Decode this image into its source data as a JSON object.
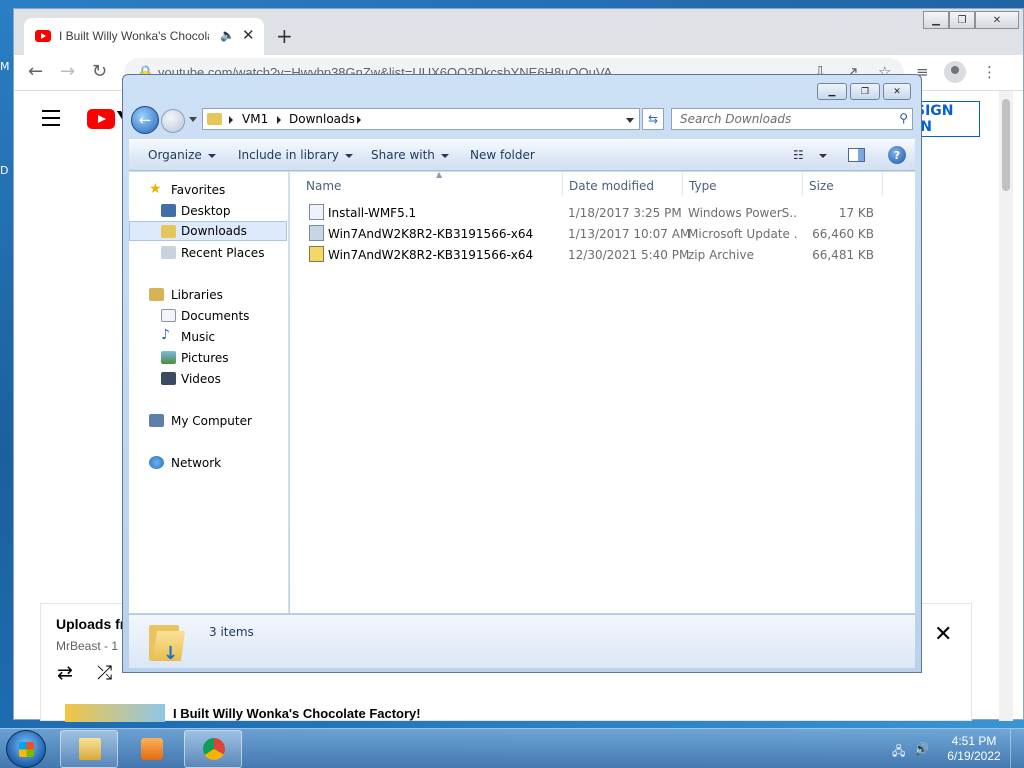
{
  "desktop": {
    "left_letters": [
      "M",
      "D"
    ]
  },
  "chrome": {
    "tab_title": "I Built Willy Wonka's Chocolate Factory!",
    "tab_audio_icon": "speaker-icon",
    "new_tab": "+",
    "url": "youtube.com/watch?v=Hwybp38GnZw&list=UUX6OQ3DkcsbYNE6H8uQQuVA",
    "sign_in": "SIGN IN",
    "logo_fragment": "Y"
  },
  "youtube": {
    "playlist_title": "Uploads fr",
    "playlist_channel": "MrBeast - 1",
    "playlist_item_title": "I Built Willy Wonka's Chocolate Factory!"
  },
  "explorer": {
    "breadcrumb": [
      "VM1",
      "Downloads"
    ],
    "search_placeholder": "Search Downloads",
    "commands": {
      "organize": "Organize",
      "include": "Include in library",
      "share": "Share with",
      "new_folder": "New folder"
    },
    "nav": {
      "favorites": "Favorites",
      "desktop": "Desktop",
      "downloads": "Downloads",
      "recent": "Recent Places",
      "libraries": "Libraries",
      "documents": "Documents",
      "music": "Music",
      "pictures": "Pictures",
      "videos": "Videos",
      "computer": "My Computer",
      "network": "Network"
    },
    "columns": {
      "name": "Name",
      "date": "Date modified",
      "type": "Type",
      "size": "Size"
    },
    "files": [
      {
        "name": "Install-WMF5.1",
        "date": "1/18/2017 3:25 PM",
        "type": "Windows PowerS...",
        "size": "17 KB"
      },
      {
        "name": "Win7AndW2K8R2-KB3191566-x64",
        "date": "1/13/2017 10:07 AM",
        "type": "Microsoft Update ...",
        "size": "66,460 KB"
      },
      {
        "name": "Win7AndW2K8R2-KB3191566-x64",
        "date": "12/30/2021 5:40 PM",
        "type": "zip Archive",
        "size": "66,481 KB"
      }
    ],
    "item_count": "3 items"
  },
  "taskbar": {
    "time": "4:51 PM",
    "date": "6/19/2022"
  },
  "colors": {
    "youtube_red": "#ff0000",
    "link_blue": "#065fd4",
    "explorer_text": "#1e395b"
  }
}
